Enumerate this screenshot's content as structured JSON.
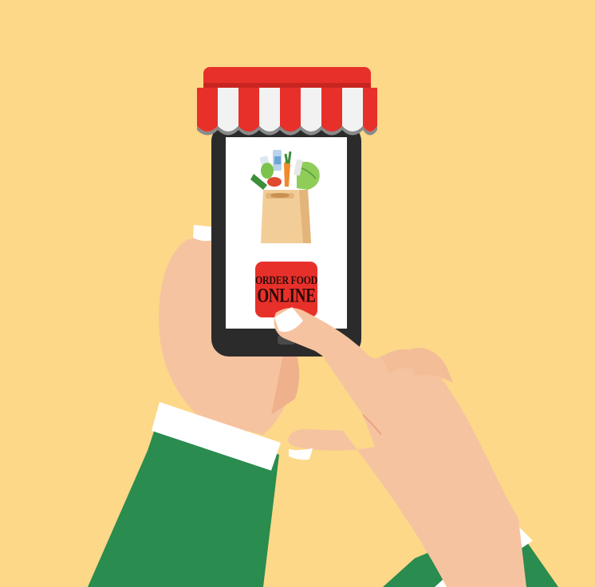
{
  "button": {
    "line1": "ORDER FOOD",
    "line2": "ONLINE"
  },
  "colors": {
    "background": "#fcd888",
    "awning_red": "#e8302a",
    "awning_white": "#f2f2f2",
    "phone_body": "#2b2b2b",
    "screen": "#ffffff",
    "skin": "#f6c3a0",
    "sleeve": "#2a8c4e",
    "button_red": "#e8302a",
    "bag": "#f3cd97"
  }
}
